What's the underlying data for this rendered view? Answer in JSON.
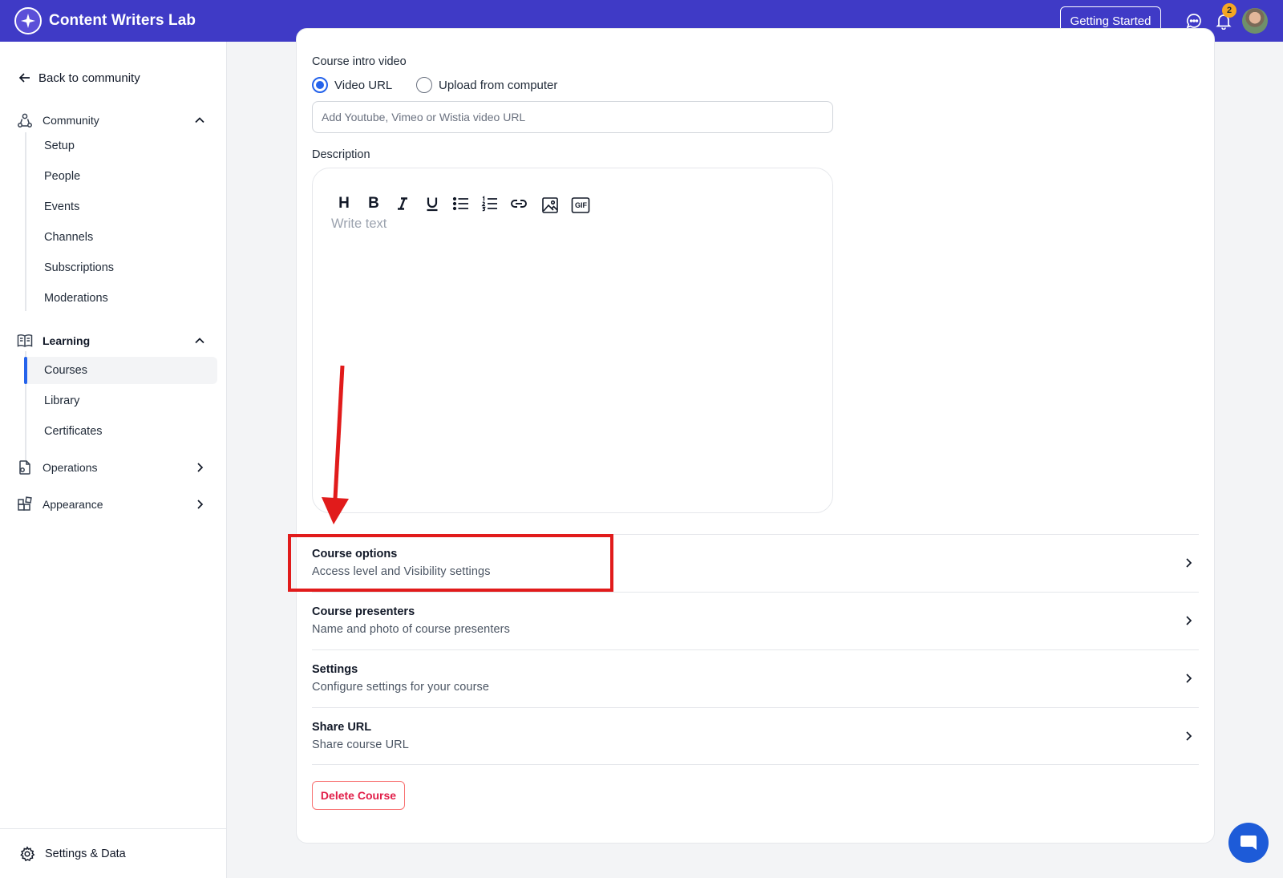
{
  "header": {
    "app_title": "Content Writers Lab",
    "getting_started_label": "Getting Started",
    "notification_count": "2",
    "brand_color": "#3f3ac6",
    "icons": [
      "sparkle-logo-icon",
      "chat-bubble-icon",
      "bell-icon"
    ]
  },
  "sidebar": {
    "back_label": "Back to community",
    "community": {
      "label": "Community",
      "items": [
        "Setup",
        "People",
        "Events",
        "Channels",
        "Subscriptions",
        "Moderations"
      ]
    },
    "learning": {
      "label": "Learning",
      "items": [
        "Courses",
        "Library",
        "Certificates"
      ],
      "active": "Courses"
    },
    "operations_label": "Operations",
    "appearance_label": "Appearance",
    "settings_label": "Settings & Data"
  },
  "form": {
    "intro_video_label": "Course intro video",
    "radio_video_url": "Video URL",
    "radio_upload": "Upload from computer",
    "radio_selected": "Video URL",
    "video_url_placeholder": "Add Youtube, Vimeo or Wistia video URL",
    "description_label": "Description",
    "editor_placeholder": "Write text",
    "toolbar": {
      "heading": "H",
      "bold": "B",
      "italic": "I",
      "underline": "U",
      "gif": "GIF"
    }
  },
  "options": [
    {
      "title": "Course options",
      "subtitle": "Access level and Visibility settings"
    },
    {
      "title": "Course presenters",
      "subtitle": "Name and photo of course presenters"
    },
    {
      "title": "Settings",
      "subtitle": "Configure settings for your course"
    },
    {
      "title": "Share URL",
      "subtitle": "Share course URL"
    }
  ],
  "delete_label": "Delete Course",
  "colors": {
    "accent_blue": "#2563eb",
    "danger": "#e11d48",
    "annotation_red": "#e11b1b"
  }
}
